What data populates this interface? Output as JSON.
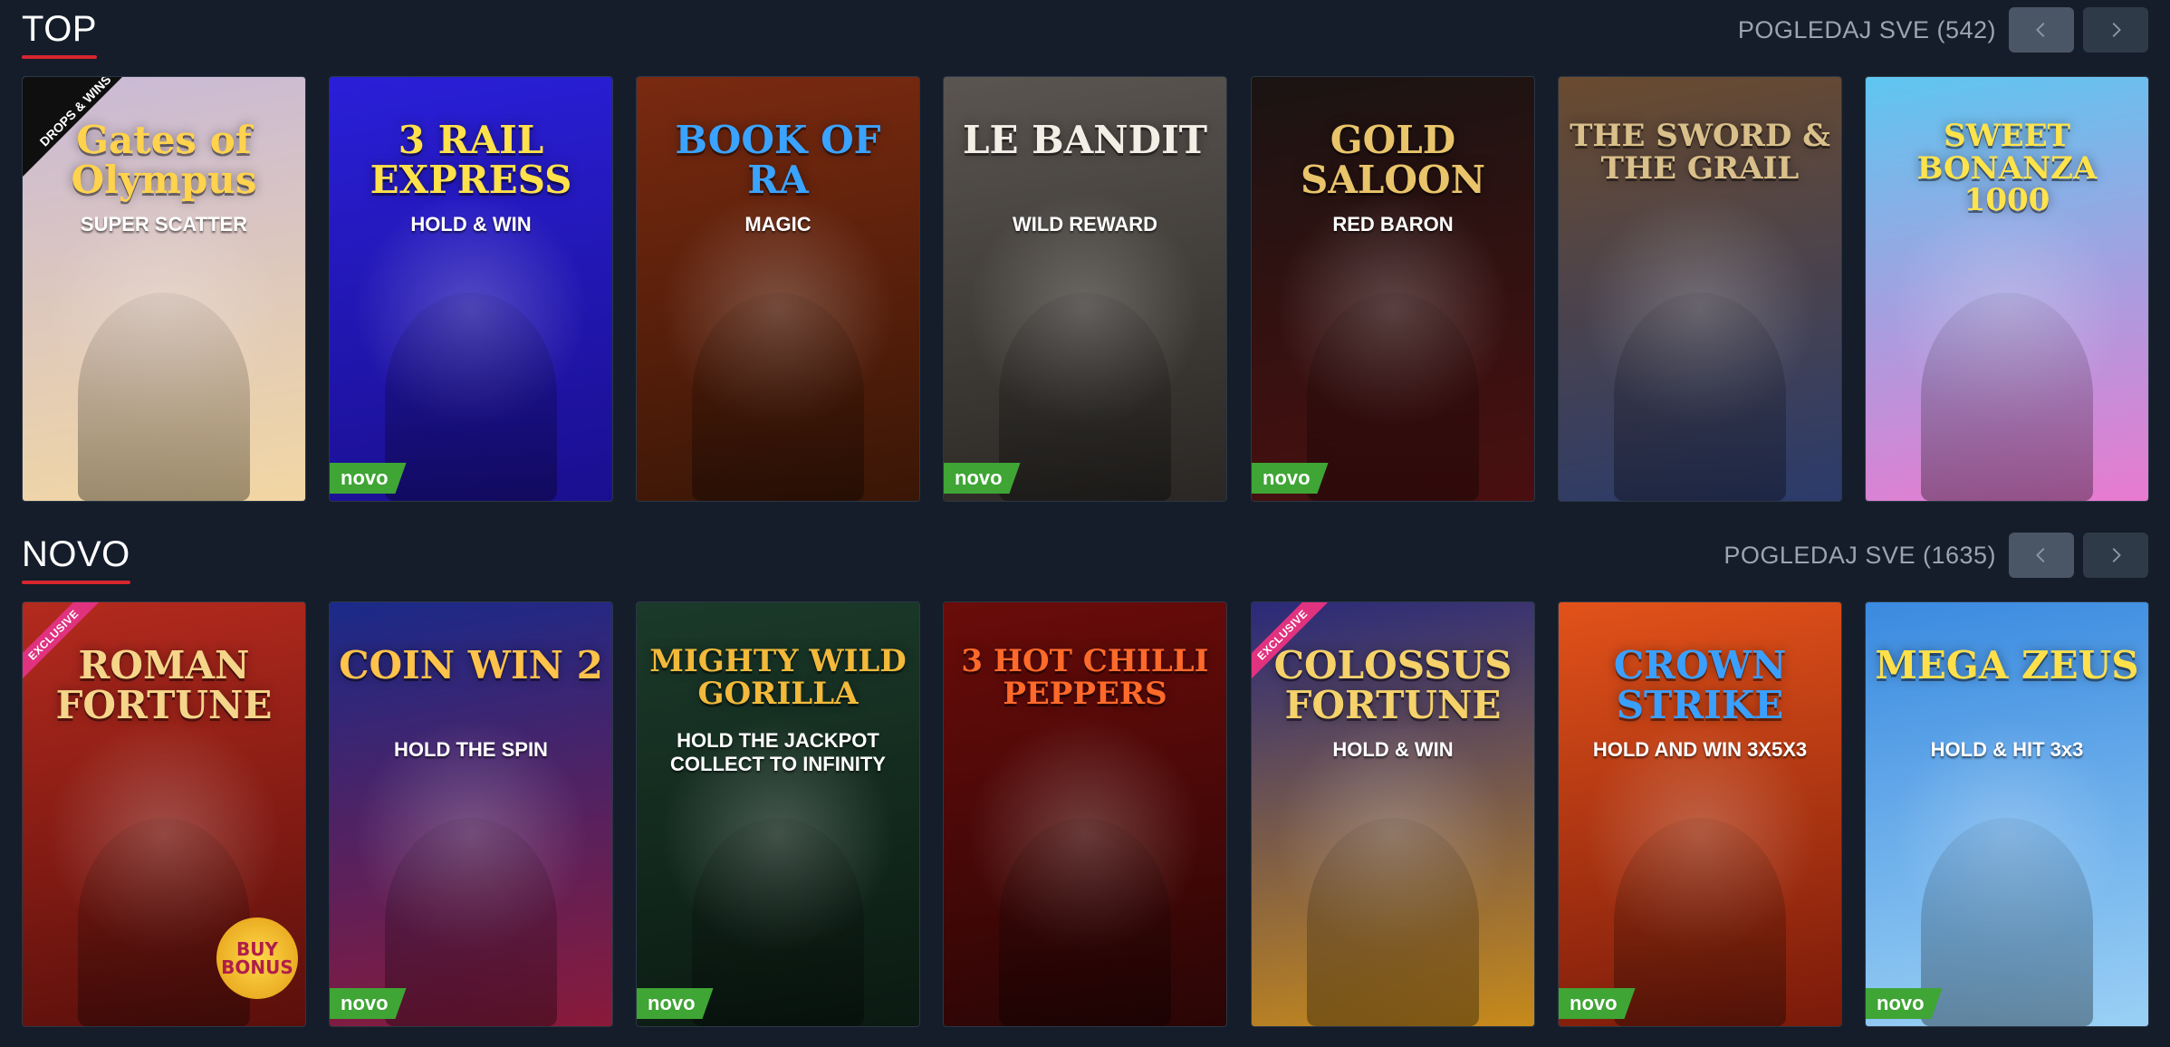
{
  "sections": [
    {
      "title": "TOP",
      "view_all": "POGLEDAJ SVE (542)",
      "games": [
        {
          "name": "Gates of Olympus",
          "subtitle": "SUPER SCATTER",
          "badge_novo": false,
          "corner": "DROPS & WINS",
          "bg": [
            "#c9b9d6",
            "#f2d7a3"
          ],
          "text": "#ffd34d"
        },
        {
          "name": "3 RAIL EXPRESS",
          "subtitle": "HOLD & WIN",
          "badge_novo": true,
          "corner": "",
          "bg": [
            "#2a1fd8",
            "#1a0f8f"
          ],
          "text": "#ffe14a"
        },
        {
          "name": "BOOK OF RA",
          "subtitle": "MAGIC",
          "badge_novo": false,
          "corner": "",
          "bg": [
            "#7a2a10",
            "#3a1606"
          ],
          "text": "#3aa3ff"
        },
        {
          "name": "LE BANDIT",
          "subtitle": "WILD REWARD",
          "badge_novo": true,
          "corner": "",
          "bg": [
            "#5a5550",
            "#2a2724"
          ],
          "text": "#f3efe6"
        },
        {
          "name": "GOLD SALOON",
          "subtitle": "RED BARON",
          "badge_novo": true,
          "corner": "",
          "bg": [
            "#1a1412",
            "#4a0f10"
          ],
          "text": "#e9c46a"
        },
        {
          "name": "THE SWORD & THE GRAIL",
          "subtitle": "",
          "badge_novo": false,
          "corner": "",
          "bg": [
            "#6a4b2f",
            "#2b3b6b"
          ],
          "text": "#d9c08a"
        },
        {
          "name": "SWEET BONANZA 1000",
          "subtitle": "",
          "badge_novo": false,
          "corner": "",
          "bg": [
            "#5ec6f0",
            "#e97ad0"
          ],
          "text": "#ffe34a"
        }
      ]
    },
    {
      "title": "NOVO",
      "view_all": "POGLEDAJ SVE (1635)",
      "games": [
        {
          "name": "ROMAN FORTUNE",
          "subtitle": "BUY BONUS",
          "badge_novo": false,
          "corner": "EXCLUSIVE",
          "bg": [
            "#b42a1e",
            "#5a0f0b"
          ],
          "text": "#f5d58a"
        },
        {
          "name": "COIN WIN 2",
          "subtitle": "HOLD THE SPIN",
          "badge_novo": true,
          "corner": "",
          "bg": [
            "#1a2a8a",
            "#8a1a3a"
          ],
          "text": "#ffc24a"
        },
        {
          "name": "MIGHTY WILD GORILLA",
          "subtitle": "HOLD THE JACKPOT COLLECT TO INFINITY",
          "badge_novo": true,
          "corner": "",
          "bg": [
            "#1b3a2a",
            "#0b1a12"
          ],
          "text": "#f2b93a"
        },
        {
          "name": "3 HOT CHILLI PEPPERS",
          "subtitle": "",
          "badge_novo": false,
          "corner": "",
          "bg": [
            "#6a0c0a",
            "#2a0505"
          ],
          "text": "#ff6a2a"
        },
        {
          "name": "COLOSSUS FORTUNE",
          "subtitle": "HOLD & WIN",
          "badge_novo": false,
          "corner": "EXCLUSIVE",
          "bg": [
            "#2a2a7a",
            "#c78a1a"
          ],
          "text": "#f5d26a"
        },
        {
          "name": "CROWN STRIKE",
          "subtitle": "HOLD AND WIN 3X5X3",
          "badge_novo": true,
          "corner": "",
          "bg": [
            "#e2521a",
            "#7a1a0a"
          ],
          "text": "#3aa0ff"
        },
        {
          "name": "MEGA ZEUS",
          "subtitle": "HOLD & HIT 3x3",
          "badge_novo": true,
          "corner": "",
          "bg": [
            "#3a8ae0",
            "#9ad0f5"
          ],
          "text": "#ffe04a"
        }
      ]
    }
  ],
  "badge_label": "novo",
  "colors": {
    "background": "#141d29",
    "accent_red": "#d7262f",
    "novo_green": "#3fa535",
    "muted_text": "#9ba4b0"
  },
  "icons": {
    "prev": "chevron-left-icon",
    "next": "chevron-right-icon"
  }
}
